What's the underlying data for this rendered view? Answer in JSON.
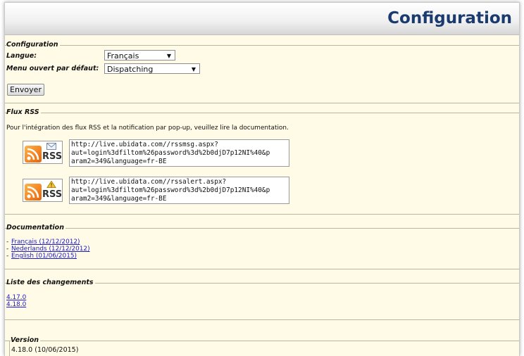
{
  "header": {
    "title": "Configuration"
  },
  "config": {
    "legend": "Configuration",
    "language_label": "Langue:",
    "language_value": "Français",
    "menu_label": "Menu ouvert par défaut:",
    "menu_value": "Dispatching",
    "submit_label": "Envoyer"
  },
  "rss": {
    "legend": "Flux RSS",
    "intro": "Pour l'intégration des flux RSS et la notification par pop-up, veuillez lire la documentation.",
    "feeds": [
      {
        "icon": "rss-message-icon",
        "badge": "RSS",
        "url_lines": [
          "http://live.ubidata.com//rssmsg.aspx?",
          "aut=login%3dfiltom%26password%3d%2b0djD7p12NI%40&p",
          "aram2=349&language=fr-BE"
        ]
      },
      {
        "icon": "rss-alert-icon",
        "badge": "RSS",
        "url_lines": [
          "http://live.ubidata.com//rssalert.aspx?",
          "aut=login%3dfiltom%26password%3d%2b0djD7p12NI%40&p",
          "aram2=349&language=fr-BE"
        ]
      }
    ]
  },
  "documentation": {
    "legend": "Documentation",
    "items": [
      {
        "prefix": "- ",
        "label": "Français (12/12/2012)"
      },
      {
        "prefix": "- ",
        "label": "Nederlands (12/12/2012)"
      },
      {
        "prefix": "- ",
        "label": "English (01/06/2015)"
      }
    ]
  },
  "changes": {
    "legend": "Liste des changements",
    "items": [
      "4.17.0",
      "4.18.0"
    ]
  },
  "version": {
    "legend": "Version",
    "value": "4.18.0 (10/06/2015)"
  },
  "colors": {
    "title": "#1b3b6f",
    "background": "#fffbe6",
    "link": "#1a1acc"
  }
}
